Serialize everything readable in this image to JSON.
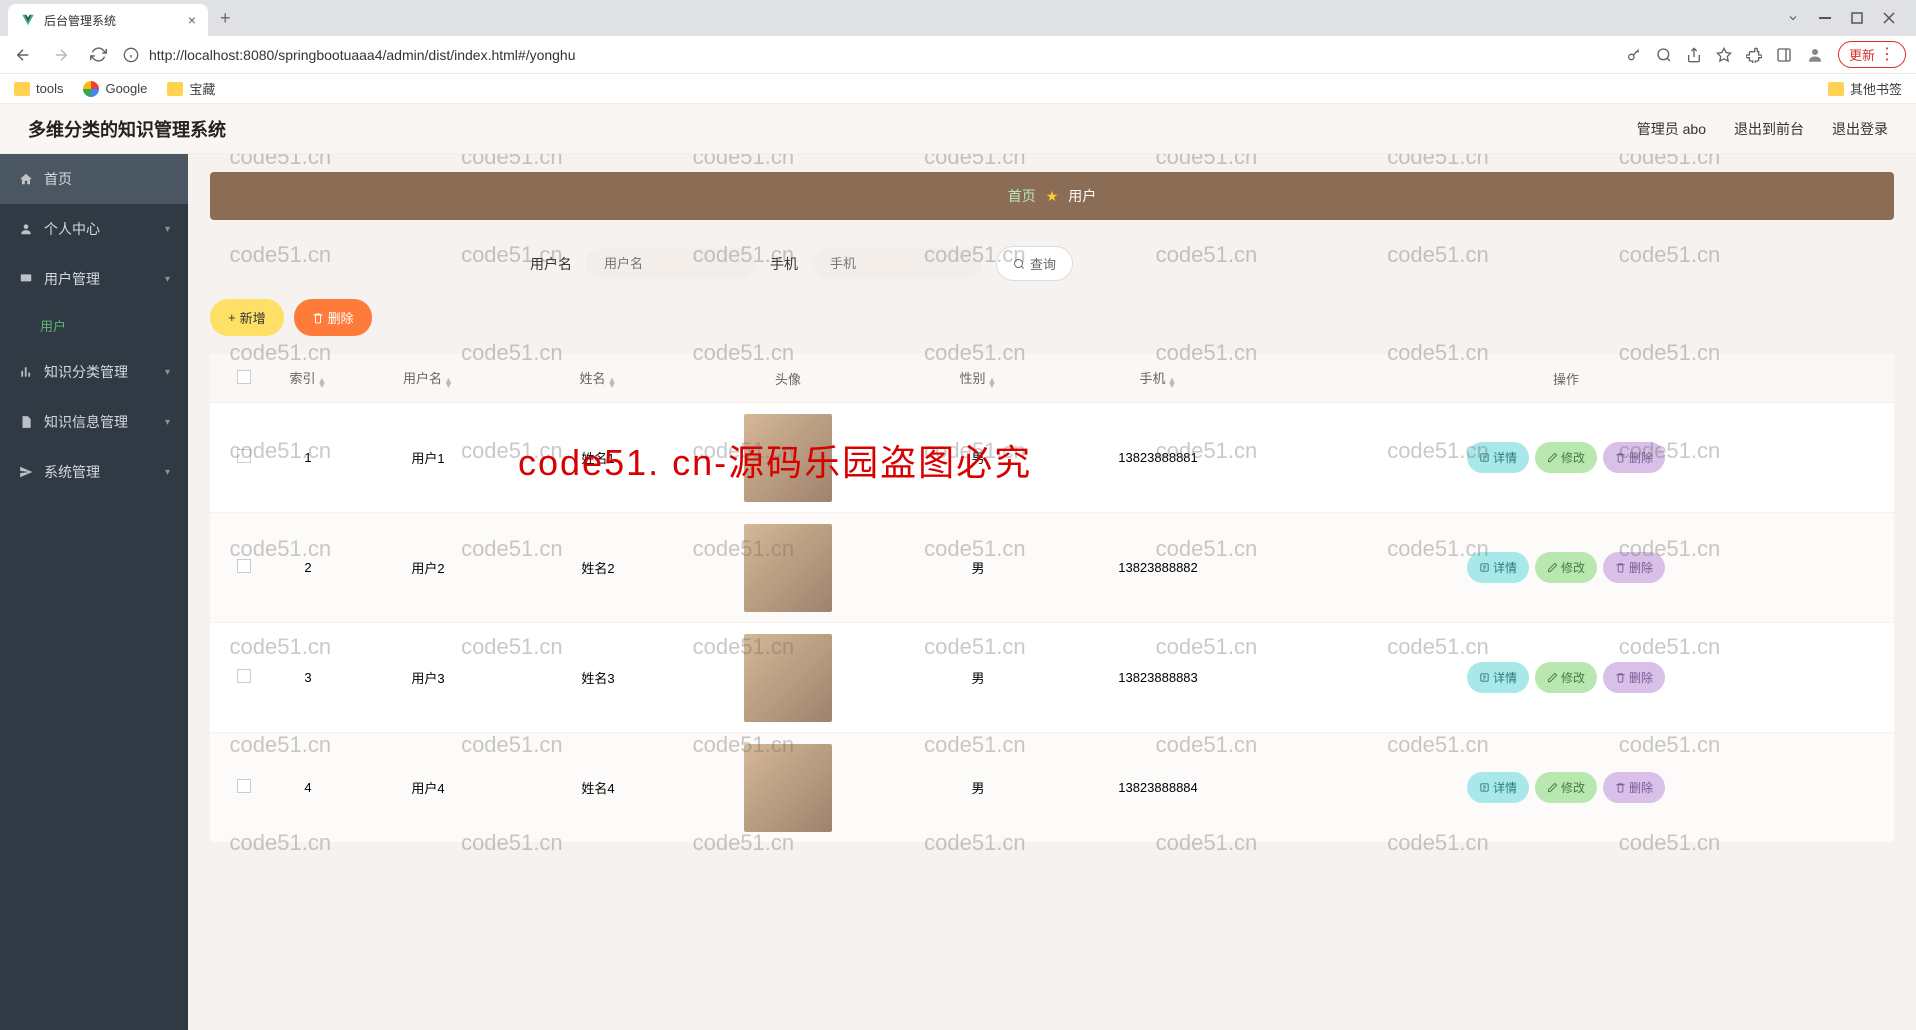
{
  "browser": {
    "tab_title": "后台管理系统",
    "url": "http://localhost:8080/springbootuaaa4/admin/dist/index.html#/yonghu",
    "update_label": "更新",
    "bookmarks": {
      "tools": "tools",
      "google": "Google",
      "treasure": "宝藏",
      "other": "其他书签"
    }
  },
  "header": {
    "app_title": "多维分类的知识管理系统",
    "admin_label": "管理员 abo",
    "exit_front": "退出到前台",
    "logout": "退出登录"
  },
  "sidebar": {
    "home": "首页",
    "personal": "个人中心",
    "user_mgmt": "用户管理",
    "user_sub": "用户",
    "category": "知识分类管理",
    "info": "知识信息管理",
    "system": "系统管理"
  },
  "crumb": {
    "home": "首页",
    "current": "用户"
  },
  "search": {
    "username_label": "用户名",
    "username_ph": "用户名",
    "phone_label": "手机",
    "phone_ph": "手机",
    "query_btn": "查询"
  },
  "actions": {
    "add": "新增",
    "delete": "删除"
  },
  "table": {
    "cols": {
      "index": "索引",
      "username": "用户名",
      "name": "姓名",
      "avatar": "头像",
      "gender": "性别",
      "phone": "手机",
      "ops": "操作"
    },
    "op_detail": "详情",
    "op_edit": "修改",
    "op_delete": "删除",
    "rows": [
      {
        "idx": "1",
        "username": "用户1",
        "name": "姓名1",
        "gender": "男",
        "phone": "13823888881"
      },
      {
        "idx": "2",
        "username": "用户2",
        "name": "姓名2",
        "gender": "男",
        "phone": "13823888882"
      },
      {
        "idx": "3",
        "username": "用户3",
        "name": "姓名3",
        "gender": "男",
        "phone": "13823888883"
      },
      {
        "idx": "4",
        "username": "用户4",
        "name": "姓名4",
        "gender": "男",
        "phone": "13823888884"
      }
    ]
  },
  "watermark": {
    "text": "code51.cn",
    "big": "code51. cn-源码乐园盗图必究"
  }
}
